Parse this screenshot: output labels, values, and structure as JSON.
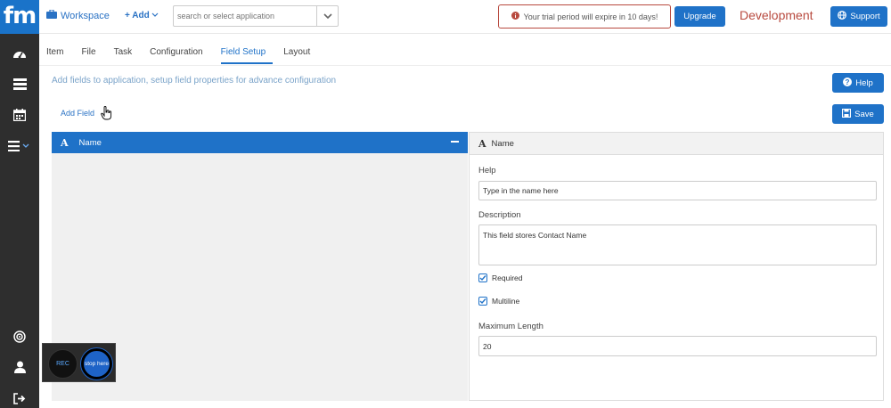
{
  "logo": "fm",
  "topbar": {
    "workspace_label": "Workspace",
    "add_label": "+ Add",
    "search_placeholder": "search or select application",
    "trial_message": "Your trial period will expire in 10 days!",
    "upgrade_label": "Upgrade",
    "environment": "Development",
    "support_label": "Support"
  },
  "tabs": [
    "Item",
    "File",
    "Task",
    "Configuration",
    "Field Setup",
    "Layout"
  ],
  "active_tab": "Field Setup",
  "hint": "Add fields to application, setup field properties for advance configuration",
  "help_label": "Help",
  "save_label": "Save",
  "add_field_label": "Add Field",
  "field_list": {
    "items": [
      {
        "icon": "A",
        "label": "Name"
      }
    ]
  },
  "properties": {
    "header_icon": "A",
    "header_label": "Name",
    "help_label": "Help",
    "help_value": "Type in the name here",
    "description_label": "Description",
    "description_value": "This field stores Contact Name",
    "required_label": "Required",
    "required_checked": true,
    "multiline_label": "Multiline",
    "multiline_checked": true,
    "max_length_label": "Maximum Length",
    "max_length_value": "20"
  },
  "recorder": {
    "rec_label": "REC",
    "stop_label": "stop here"
  },
  "colors": {
    "primary": "#1f72c8",
    "sidebar": "#2e2e2e",
    "alert": "#b84a3f"
  },
  "icons": [
    "dashboard-icon",
    "layers-icon",
    "calendar-icon",
    "menu-icon",
    "target-icon",
    "user-icon",
    "logout-icon",
    "briefcase-icon",
    "info-icon",
    "globe-icon",
    "question-icon",
    "save-icon"
  ]
}
